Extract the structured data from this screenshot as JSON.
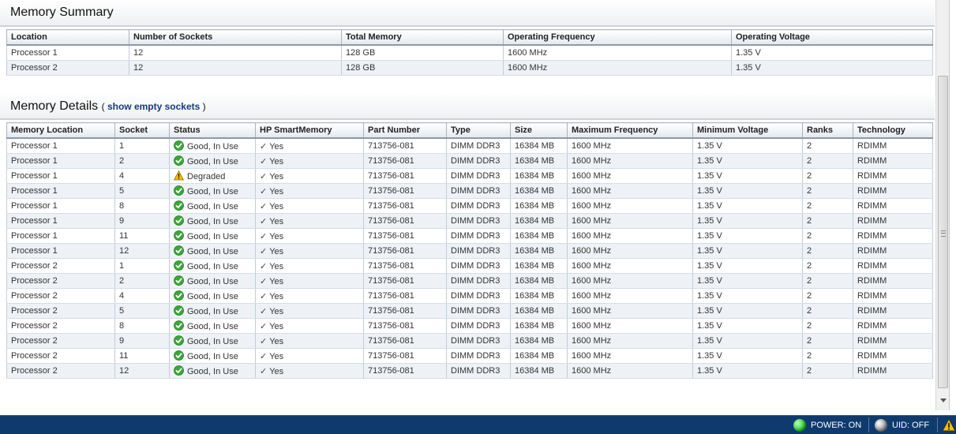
{
  "summary": {
    "title": "Memory Summary",
    "columns": [
      "Location",
      "Number of Sockets",
      "Total Memory",
      "Operating Frequency",
      "Operating Voltage"
    ],
    "rows": [
      [
        "Processor 1",
        "12",
        "128 GB",
        "1600 MHz",
        "1.35 V"
      ],
      [
        "Processor 2",
        "12",
        "128 GB",
        "1600 MHz",
        "1.35 V"
      ]
    ]
  },
  "details": {
    "title": "Memory Details",
    "link_open": "( ",
    "link_label": "show empty sockets",
    "link_close": " )",
    "columns": [
      "Memory Location",
      "Socket",
      "Status",
      "HP SmartMemory",
      "Part Number",
      "Type",
      "Size",
      "Maximum Frequency",
      "Minimum Voltage",
      "Ranks",
      "Technology"
    ],
    "rows": [
      [
        "Processor 1",
        "1",
        "Good, In Use",
        "Yes",
        "713756-081",
        "DIMM DDR3",
        "16384 MB",
        "1600 MHz",
        "1.35 V",
        "2",
        "RDIMM"
      ],
      [
        "Processor 1",
        "2",
        "Good, In Use",
        "Yes",
        "713756-081",
        "DIMM DDR3",
        "16384 MB",
        "1600 MHz",
        "1.35 V",
        "2",
        "RDIMM"
      ],
      [
        "Processor 1",
        "4",
        "Degraded",
        "Yes",
        "713756-081",
        "DIMM DDR3",
        "16384 MB",
        "1600 MHz",
        "1.35 V",
        "2",
        "RDIMM"
      ],
      [
        "Processor 1",
        "5",
        "Good, In Use",
        "Yes",
        "713756-081",
        "DIMM DDR3",
        "16384 MB",
        "1600 MHz",
        "1.35 V",
        "2",
        "RDIMM"
      ],
      [
        "Processor 1",
        "8",
        "Good, In Use",
        "Yes",
        "713756-081",
        "DIMM DDR3",
        "16384 MB",
        "1600 MHz",
        "1.35 V",
        "2",
        "RDIMM"
      ],
      [
        "Processor 1",
        "9",
        "Good, In Use",
        "Yes",
        "713756-081",
        "DIMM DDR3",
        "16384 MB",
        "1600 MHz",
        "1.35 V",
        "2",
        "RDIMM"
      ],
      [
        "Processor 1",
        "11",
        "Good, In Use",
        "Yes",
        "713756-081",
        "DIMM DDR3",
        "16384 MB",
        "1600 MHz",
        "1.35 V",
        "2",
        "RDIMM"
      ],
      [
        "Processor 1",
        "12",
        "Good, In Use",
        "Yes",
        "713756-081",
        "DIMM DDR3",
        "16384 MB",
        "1600 MHz",
        "1.35 V",
        "2",
        "RDIMM"
      ],
      [
        "Processor 2",
        "1",
        "Good, In Use",
        "Yes",
        "713756-081",
        "DIMM DDR3",
        "16384 MB",
        "1600 MHz",
        "1.35 V",
        "2",
        "RDIMM"
      ],
      [
        "Processor 2",
        "2",
        "Good, In Use",
        "Yes",
        "713756-081",
        "DIMM DDR3",
        "16384 MB",
        "1600 MHz",
        "1.35 V",
        "2",
        "RDIMM"
      ],
      [
        "Processor 2",
        "4",
        "Good, In Use",
        "Yes",
        "713756-081",
        "DIMM DDR3",
        "16384 MB",
        "1600 MHz",
        "1.35 V",
        "2",
        "RDIMM"
      ],
      [
        "Processor 2",
        "5",
        "Good, In Use",
        "Yes",
        "713756-081",
        "DIMM DDR3",
        "16384 MB",
        "1600 MHz",
        "1.35 V",
        "2",
        "RDIMM"
      ],
      [
        "Processor 2",
        "8",
        "Good, In Use",
        "Yes",
        "713756-081",
        "DIMM DDR3",
        "16384 MB",
        "1600 MHz",
        "1.35 V",
        "2",
        "RDIMM"
      ],
      [
        "Processor 2",
        "9",
        "Good, In Use",
        "Yes",
        "713756-081",
        "DIMM DDR3",
        "16384 MB",
        "1600 MHz",
        "1.35 V",
        "2",
        "RDIMM"
      ],
      [
        "Processor 2",
        "11",
        "Good, In Use",
        "Yes",
        "713756-081",
        "DIMM DDR3",
        "16384 MB",
        "1600 MHz",
        "1.35 V",
        "2",
        "RDIMM"
      ],
      [
        "Processor 2",
        "12",
        "Good, In Use",
        "Yes",
        "713756-081",
        "DIMM DDR3",
        "16384 MB",
        "1600 MHz",
        "1.35 V",
        "2",
        "RDIMM"
      ]
    ],
    "status_icons": {
      "Good, In Use": "ok-status-icon",
      "Degraded": "warning-status-icon"
    },
    "smartmemory_icon": "checkmark-icon"
  },
  "footer": {
    "power_label": "POWER: ON",
    "uid_label": "UID: OFF",
    "power_led_color": "#2fd12f",
    "uid_led_color": "#9a9a9a",
    "alert_icon": "warning-triangle-icon"
  },
  "colors": {
    "ok_green": "#3aa83a",
    "warning_yellow": "#f2c200",
    "footer_bg": "#0f3a6e",
    "link_blue": "#1a3a7a"
  }
}
